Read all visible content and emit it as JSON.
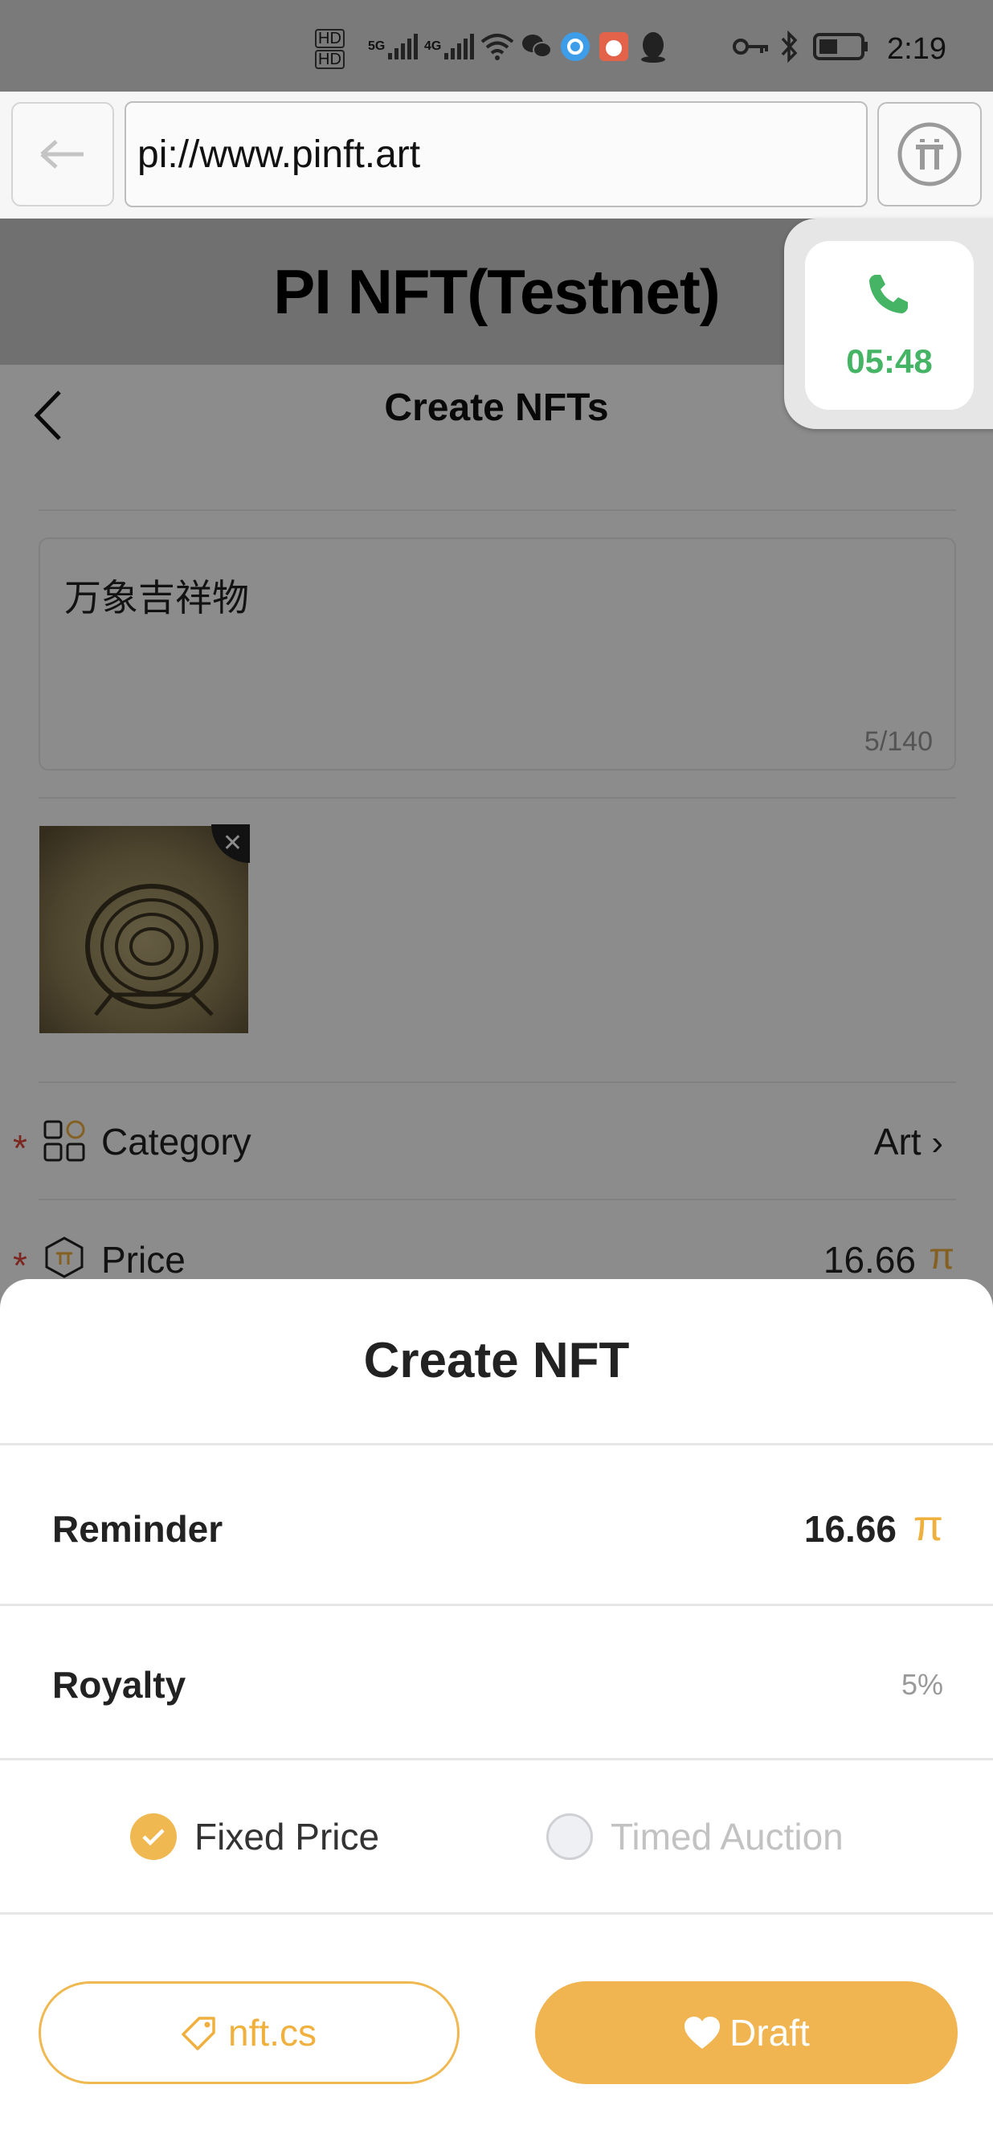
{
  "status_bar": {
    "time": "2:19",
    "hd1": "HD",
    "hd2": "HD",
    "net1": "5G",
    "net2": "4G"
  },
  "browser": {
    "url": "pi://www.pinft.art"
  },
  "app": {
    "title": "PI NFT(Testnet)"
  },
  "page": {
    "nav_title": "Create NFTs",
    "description": "万象吉祥物",
    "char_count": "5/140",
    "category_label": "Category",
    "category_value": "Art",
    "price_label": "Price",
    "price_value": "16.66",
    "currency_symbol": "π",
    "required_mark": "*"
  },
  "call": {
    "timer": "05:48"
  },
  "sheet": {
    "title": "Create NFT",
    "reminder_label": "Reminder",
    "reminder_value": "16.66",
    "currency_symbol": "π",
    "royalty_label": "Royalty",
    "royalty_value": "5%",
    "option_fixed": "Fixed Price",
    "option_timed": "Timed Auction",
    "selected_option": "Fixed Price",
    "btn_left": "nft.cs",
    "btn_right": "Draft"
  },
  "colors": {
    "accent": "#f0b450",
    "call_green": "#45b565",
    "required_red": "#e0453a"
  }
}
